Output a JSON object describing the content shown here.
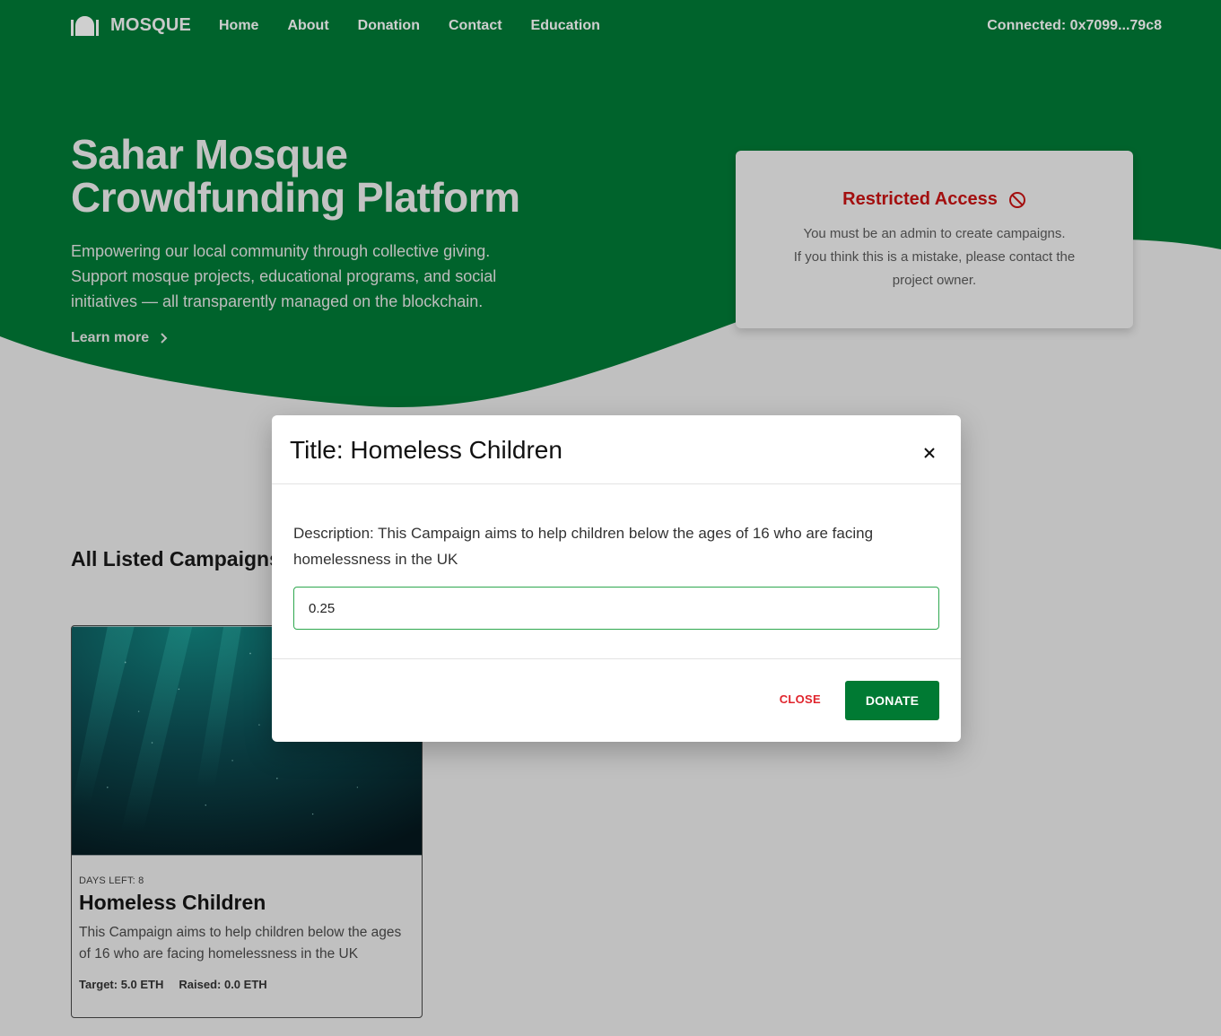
{
  "nav": {
    "brand": "MOSQUE",
    "links": [
      "Home",
      "About",
      "Donation",
      "Contact",
      "Education"
    ],
    "wallet": "Connected: 0x7099...79c8"
  },
  "hero": {
    "title_line1": "Sahar Mosque",
    "title_line2": "Crowdfunding Platform",
    "description": "Empowering our local community through collective giving. Support mosque projects, educational programs, and social initiatives — all transparently managed on the blockchain.",
    "learn_more": "Learn more"
  },
  "restricted": {
    "title": "Restricted Access",
    "line1": "You must be an admin to create campaigns.",
    "line2": "If you think this is a mistake, please contact the",
    "line3": "project owner."
  },
  "campaigns": {
    "section_title": "All Listed Campaigns",
    "items": [
      {
        "days_left": "DAYS LEFT: 8",
        "title": "Homeless Children",
        "description": "This Campaign aims to help children below the ages of 16 who are facing homelessness in the UK",
        "target": "Target: 5.0 ETH",
        "raised": "Raised: 0.0 ETH"
      }
    ]
  },
  "modal": {
    "title": "Title: Homeless Children",
    "description": "Description: This Campaign aims to help children below the ages of 16 who are facing homelessness in the UK",
    "amount_value": "0.25",
    "close_label": "CLOSE",
    "donate_label": "DONATE"
  },
  "colors": {
    "primary_green": "#00632c",
    "donate_green": "#007a33",
    "restricted_red": "#a30f0f",
    "close_red": "#e0242c",
    "backdrop": "#c0c0c0"
  }
}
